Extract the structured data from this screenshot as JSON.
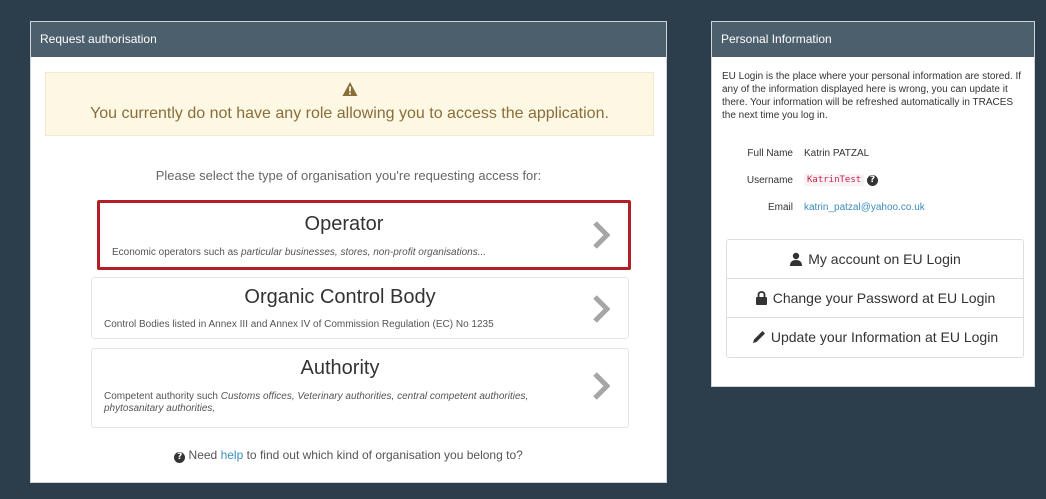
{
  "request_panel": {
    "title": "Request authorisation",
    "alert_text": "You currently do not have any role allowing you to access the application.",
    "alert_icon": "warning-icon",
    "prompt": "Please select the type of organisation you're requesting access for:",
    "cards": [
      {
        "title": "Operator",
        "desc_prefix": "Economic operators such as ",
        "desc_italic": "particular businesses, stores, non-profit organisations...",
        "desc_suffix": "",
        "selected": true
      },
      {
        "title": "Organic Control Body",
        "desc_prefix": "Control Bodies listed in Annex III and Annex IV of Commission Regulation (EC) No 1235",
        "desc_italic": "",
        "desc_suffix": "",
        "selected": false
      },
      {
        "title": "Authority",
        "desc_prefix": "Competent authority such ",
        "desc_italic": "Customs offices, Veterinary authorities, central competent authorities, phytosanitary authorities,",
        "desc_suffix": "",
        "selected": false
      }
    ],
    "help_prefix": "Need ",
    "help_link": "help",
    "help_suffix": " to find out which kind of organisation you belong to?"
  },
  "info_panel": {
    "title": "Personal Information",
    "description": "EU Login is the place where your personal information are stored. If any of the information displayed here is wrong, you can update it there. Your information will be refreshed automatically in TRACES the next time you log in.",
    "fields": {
      "full_name_label": "Full Name",
      "full_name": "Katrin PATZAL",
      "username_label": "Username",
      "username": "KatrinTest",
      "email_label": "Email",
      "email": "katrin_patzal@yahoo.co.uk"
    },
    "buttons": {
      "account": "My account on EU Login",
      "password": "Change your Password at EU Login",
      "update": "Update your Information at EU Login"
    }
  },
  "colors": {
    "background": "#2c3e4c",
    "panel_header": "#4c5f6d",
    "alert_bg": "#fcf8e3",
    "alert_text": "#8a6d3b",
    "selected_border": "#b31f24",
    "link": "#3c8dbc"
  }
}
